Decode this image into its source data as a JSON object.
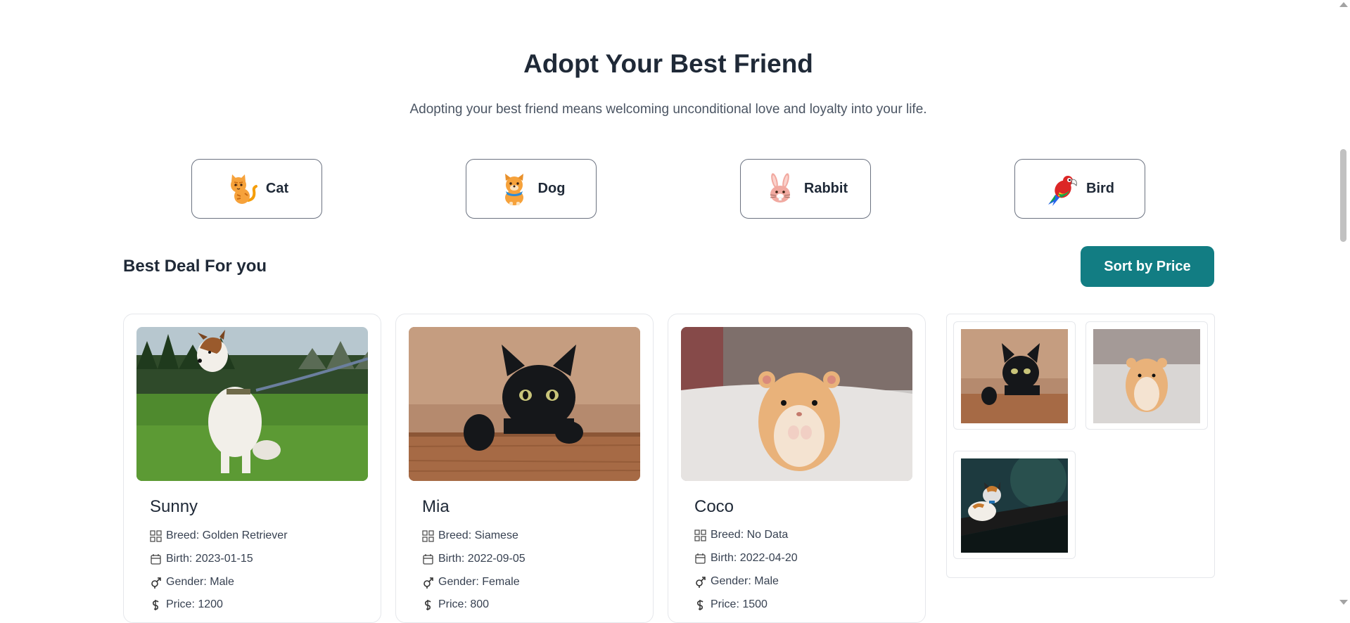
{
  "hero": {
    "title": "Adopt Your Best Friend",
    "subtitle": "Adopting your best friend means welcoming unconditional love and loyalty into your life."
  },
  "categories": [
    {
      "label": "Cat",
      "icon": "cat-emoji-icon"
    },
    {
      "label": "Dog",
      "icon": "dog-emoji-icon"
    },
    {
      "label": "Rabbit",
      "icon": "rabbit-emoji-icon"
    },
    {
      "label": "Bird",
      "icon": "parrot-emoji-icon"
    }
  ],
  "deals": {
    "title": "Best Deal For you",
    "sort_label": "Sort by Price"
  },
  "pets": [
    {
      "name": "Sunny",
      "breed": "Breed: Golden Retriever",
      "birth": "Birth: 2023-01-15",
      "gender": "Gender: Male",
      "price": "Price: 1200",
      "photo": "dog-photo"
    },
    {
      "name": "Mia",
      "breed": "Breed: Siamese",
      "birth": "Birth: 2022-09-05",
      "gender": "Gender: Female",
      "price": "Price: 800",
      "photo": "black-cat-photo"
    },
    {
      "name": "Coco",
      "breed": "Breed: No Data",
      "birth": "Birth: 2022-04-20",
      "gender": "Gender: Male",
      "price": "Price: 1500",
      "photo": "hamster-photo"
    }
  ],
  "gallery": [
    "black-cat-photo",
    "hamster-photo",
    "calico-cat-photo"
  ],
  "colors": {
    "accent": "#127d83",
    "text": "#1f2937",
    "muted": "#4b5563",
    "border": "#e5e7eb"
  }
}
